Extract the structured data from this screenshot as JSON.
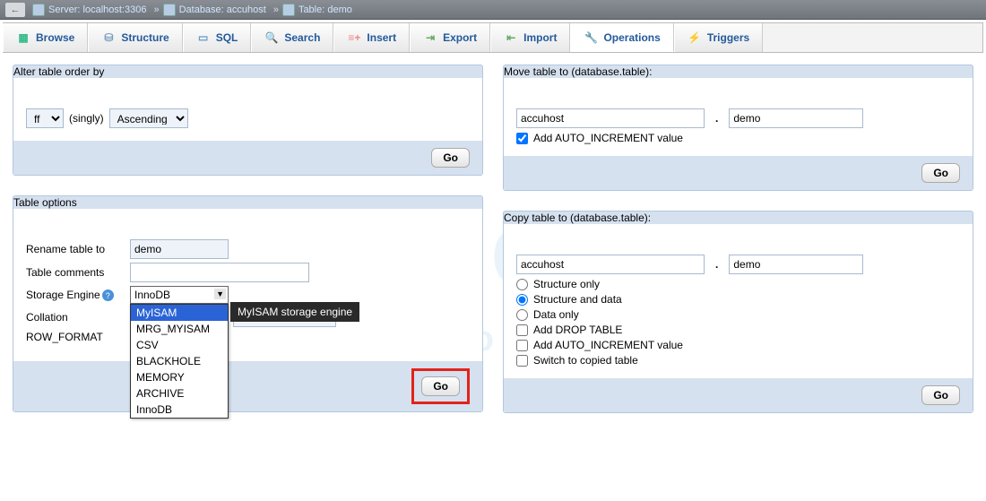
{
  "breadcrumb": {
    "server_label": "Server: localhost:3306",
    "database_label": "Database: accuhost",
    "table_label": "Table: demo",
    "sep": "»"
  },
  "tabs": {
    "browse": "Browse",
    "structure": "Structure",
    "sql": "SQL",
    "search": "Search",
    "insert": "Insert",
    "export": "Export",
    "import": "Import",
    "operations": "Operations",
    "triggers": "Triggers"
  },
  "labels": {
    "go": "Go"
  },
  "alter_order": {
    "legend": "Alter table order by",
    "column_selected": "ff",
    "mode": "(singly)",
    "direction": "Ascending"
  },
  "move_table": {
    "legend": "Move table to (database.table):",
    "database": "accuhost",
    "table": "demo",
    "auto_inc_label": "Add AUTO_INCREMENT value",
    "auto_inc_checked": true
  },
  "table_options": {
    "legend": "Table options",
    "rename_label": "Rename table to",
    "rename_value": "demo",
    "comments_label": "Table comments",
    "comments_value": "",
    "storage_label": "Storage Engine",
    "storage_selected": "InnoDB",
    "collation_label": "Collation",
    "rowformat_label": "ROW_FORMAT",
    "engine_options": [
      "MyISAM",
      "MRG_MYISAM",
      "CSV",
      "BLACKHOLE",
      "MEMORY",
      "ARCHIVE",
      "InnoDB"
    ],
    "engine_tooltip": "MyISAM storage engine"
  },
  "copy_table": {
    "legend": "Copy table to (database.table):",
    "database": "accuhost",
    "table": "demo",
    "opt_structure_only": "Structure only",
    "opt_structure_data": "Structure and data",
    "opt_data_only": "Data only",
    "selected_option": "structure_data",
    "add_drop_label": "Add DROP TABLE",
    "add_auto_inc_label": "Add AUTO_INCREMENT value",
    "switch_label": "Switch to copied table"
  }
}
